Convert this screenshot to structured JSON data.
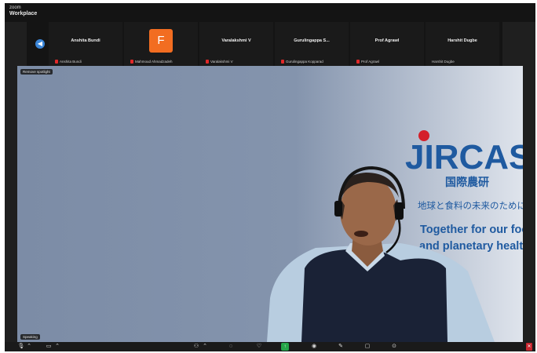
{
  "app": {
    "title": "zoom",
    "subtitle": "Workplace"
  },
  "participants": [
    {
      "name": "Anshita Bundi",
      "label": "Anshita Bundi",
      "muted": true
    },
    {
      "name": "",
      "avatar_letter": "F",
      "avatar_color": "#f26d21",
      "label": "Mahmoud Ahmadzadeh",
      "muted": true
    },
    {
      "name": "Varalakshmi V",
      "label": "Varalakshmi V",
      "muted": true
    },
    {
      "name": "Gurulingappa S...",
      "label": "Gurulingappa Kopparad",
      "muted": true
    },
    {
      "name": "Prof Agrawl",
      "label": "Prof Agrawl",
      "muted": true
    },
    {
      "name": "Harshit Dugbe",
      "label": "Harshit Dugbe",
      "muted": false
    }
  ],
  "main_video": {
    "spotlight_label": "Remove spotlight",
    "speaker_label": "Speaking",
    "logo_text": "JIRCAS",
    "logo_jp": "国際農研",
    "jp_tagline": "地球と食料の未来のために",
    "en_tagline_1": "Together for our food",
    "en_tagline_2": "and planetary health"
  },
  "colors": {
    "brand_blue": "#1f5aa0",
    "brand_red": "#d4202a",
    "mute_red": "#e02828",
    "share_green": "#25a548"
  },
  "toolbar": {
    "icons": [
      "microphone-icon",
      "video-camera-icon",
      "participants-icon",
      "chat-icon",
      "reactions-icon",
      "share-screen-icon",
      "record-icon",
      "apps-icon",
      "whiteboard-icon",
      "more-icon",
      "end-meeting-icon"
    ]
  }
}
